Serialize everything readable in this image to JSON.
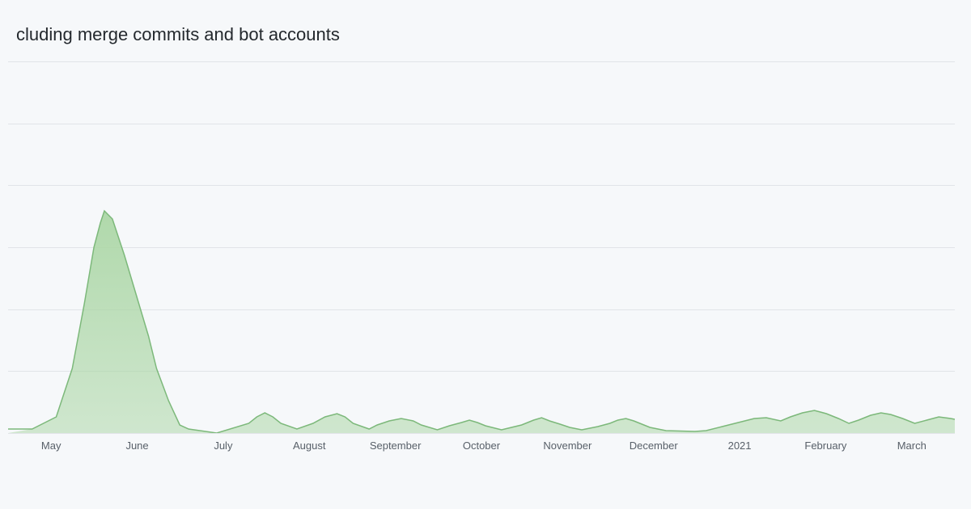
{
  "title": "cluding merge commits and bot accounts",
  "colors": {
    "fill": "#a8d5a2",
    "stroke": "#7cb87a",
    "grid": "#e1e4e8",
    "background": "#f6f8fa",
    "text": "#586069",
    "title": "#24292e"
  },
  "xLabels": [
    "May",
    "June",
    "July",
    "August",
    "September",
    "October",
    "November",
    "December",
    "2021",
    "February",
    "March"
  ],
  "chart": {
    "description": "Commit activity area chart showing a large spike in May-June, then smaller bumps through the rest of 2020 and into early 2021"
  }
}
